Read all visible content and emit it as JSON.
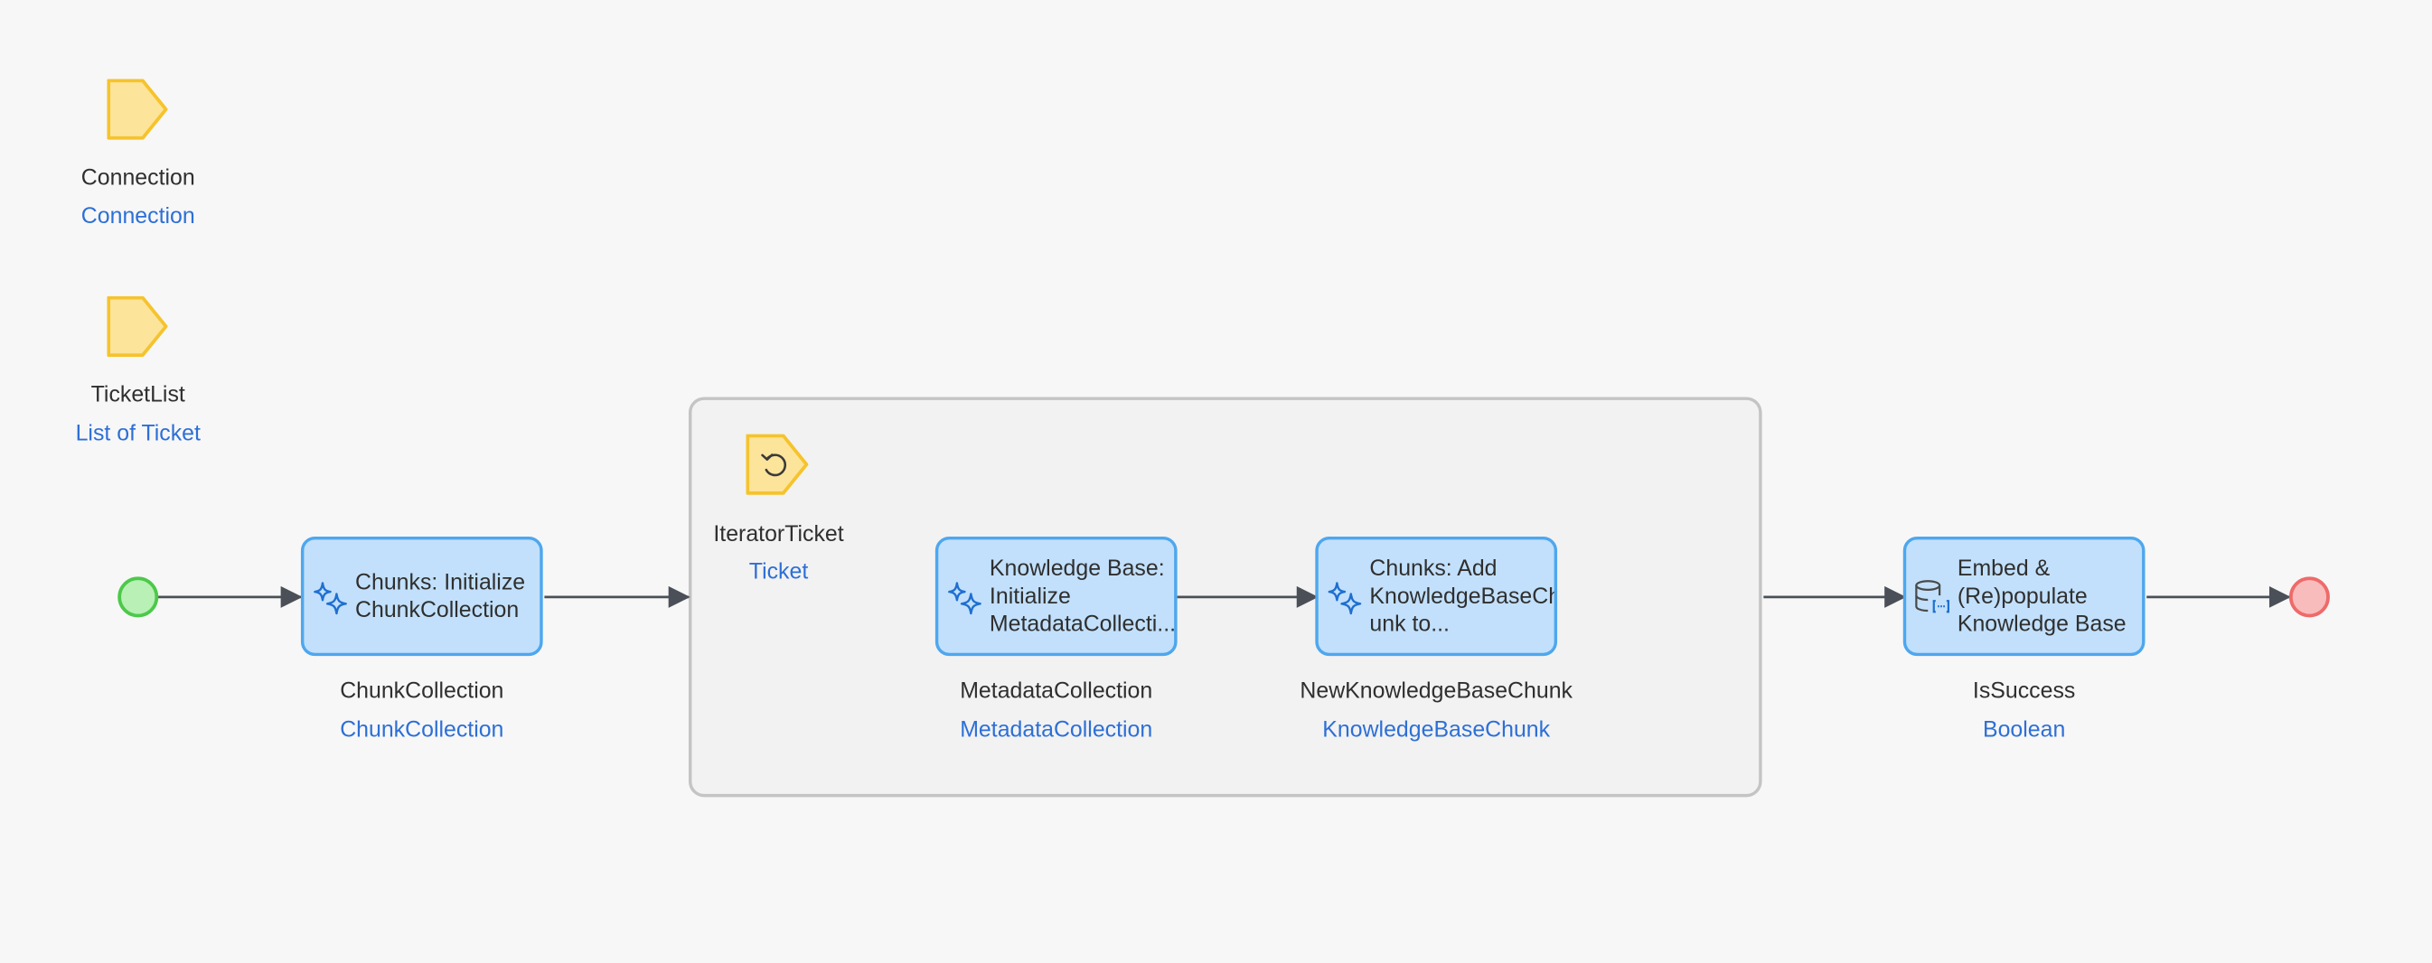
{
  "parameters": [
    {
      "name": "Connection",
      "type": "Connection"
    },
    {
      "name": "TicketList",
      "type": "List of Ticket"
    }
  ],
  "actions": [
    {
      "id": "init-chunk",
      "text": "Chunks: Initialize\nChunkCollection",
      "output_name": "ChunkCollection",
      "output_type": "ChunkCollection",
      "icon": "sparkle-icon"
    },
    {
      "id": "init-metadata",
      "text": "Knowledge Base:\nInitialize\nMetadataCollecti...",
      "output_name": "MetadataCollection",
      "output_type": "MetadataCollection",
      "icon": "sparkle-icon"
    },
    {
      "id": "add-chunk",
      "text": "Chunks: Add\nKnowledgeBaseCh\nunk to...",
      "output_name": "NewKnowledgeBaseChunk",
      "output_type": "KnowledgeBaseChunk",
      "icon": "sparkle-icon"
    },
    {
      "id": "embed",
      "text": "Embed &\n(Re)populate\nKnowledge Base",
      "output_name": "IsSuccess",
      "output_type": "Boolean",
      "icon": "database-icon"
    }
  ],
  "loop": {
    "iterator_name": "IteratorTicket",
    "iterator_type": "Ticket",
    "icon": "loop-icon"
  },
  "events": {
    "start": "start-event",
    "end": "end-event"
  },
  "colors": {
    "background": "#f7f7f7",
    "action_fill": "#c2e0fb",
    "action_border": "#4ea7ee",
    "parameter_fill": "#fde49b",
    "parameter_border": "#f5c32d",
    "start_fill": "#b9f0b5",
    "start_border": "#4cc94a",
    "end_fill": "#f8bcbc",
    "end_border": "#ee6a6a",
    "type_text": "#2d6fd6",
    "flow_line": "#4b4f57"
  }
}
